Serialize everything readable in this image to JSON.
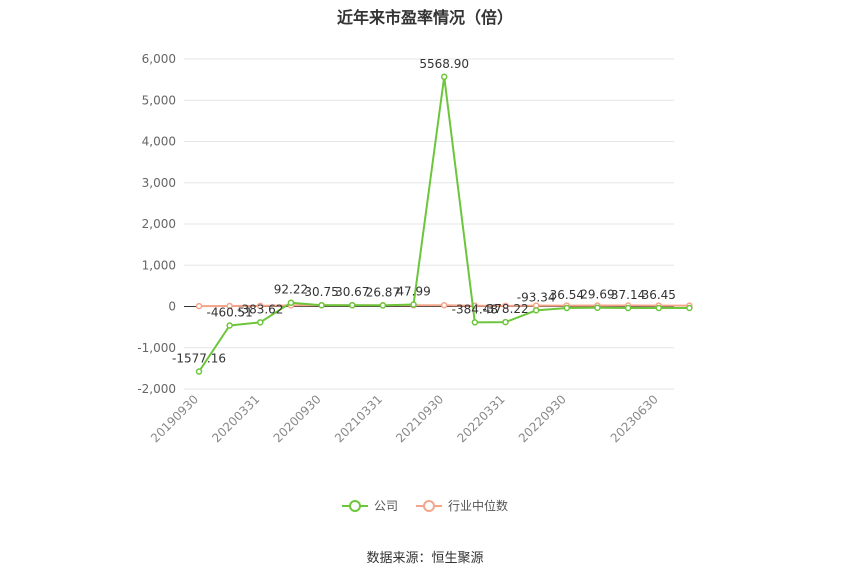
{
  "title": "近年来市盈率情况（倍）",
  "source": "数据来源：恒生聚源",
  "legend": [
    {
      "label": "公司",
      "color": "#6cc63b"
    },
    {
      "label": "行业中位数",
      "color": "#f4a58a"
    }
  ],
  "chart_data": {
    "type": "line",
    "title": "近年来市盈率情况（倍）",
    "x_tick_labels": [
      "20190930",
      "20200331",
      "20200930",
      "20210331",
      "20210930",
      "20220331",
      "20220930",
      "20230630"
    ],
    "x": [
      "20190930",
      "20191231",
      "20200331",
      "20200630",
      "20200930",
      "20201231",
      "20210331",
      "20210630",
      "20210930",
      "20211231",
      "20220331",
      "20220630",
      "20220930",
      "20221231",
      "20230331",
      "20230630",
      "20230930"
    ],
    "ylim": [
      -2000,
      6000
    ],
    "yticks": [
      -2000,
      -1000,
      0,
      1000,
      2000,
      3000,
      4000,
      5000,
      6000
    ],
    "ytick_labels": [
      "-2,000",
      "-1,000",
      "0",
      "1,000",
      "2,000",
      "3,000",
      "4,000",
      "5,000",
      "6,000"
    ],
    "grid": true,
    "legend_position": "bottom",
    "series": [
      {
        "name": "公司",
        "color": "#6cc63b",
        "values": [
          -1577.16,
          -460.51,
          -383.62,
          92.22,
          30.75,
          30.67,
          26.87,
          47.99,
          5568.9,
          -384.48,
          -378.22,
          -93.34,
          -36.54,
          -29.69,
          -37.14,
          -36.45,
          -36.45
        ],
        "labels": [
          "-1577.16",
          "-460.51",
          "-383.62",
          "92.22",
          "30.75",
          "30.67",
          "26.87",
          "47.99",
          "5568.90",
          "-384.48",
          "-378.22",
          "-93.34",
          "36.54",
          "29.69",
          "37.14",
          "36.45",
          ""
        ]
      },
      {
        "name": "行业中位数",
        "color": "#f4a58a",
        "values": [
          10,
          12,
          14,
          28,
          30,
          31,
          30,
          29,
          30,
          18,
          16,
          20,
          22,
          24,
          23,
          22,
          21
        ]
      }
    ]
  }
}
